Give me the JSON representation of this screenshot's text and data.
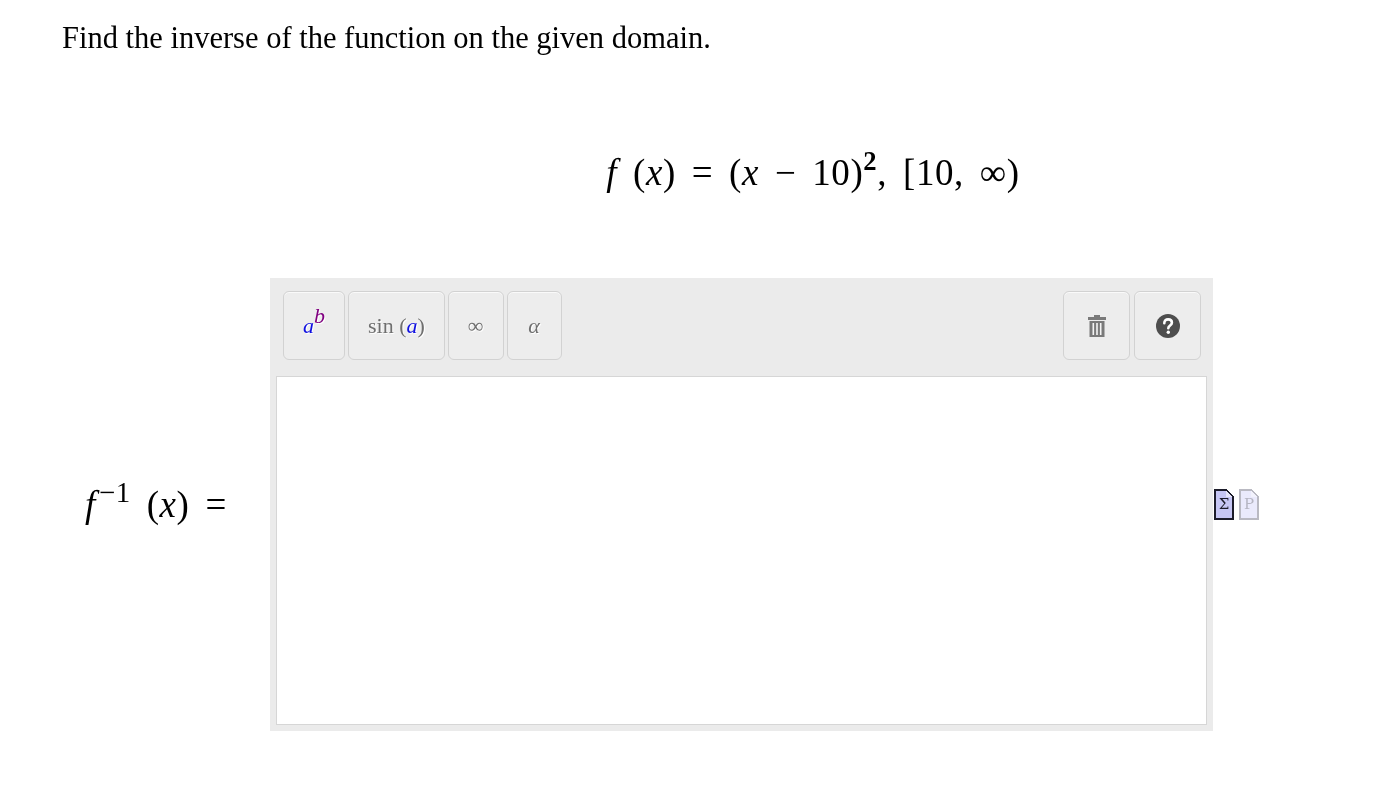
{
  "prompt": "Find the inverse of the function on the given domain.",
  "equation": "*f* (*x*) = (*x* − 10)$^{2}$, [10, ∞)",
  "answer": {
    "label": "*f*$^{−1}$ (*x*) =",
    "toolbar": {
      "buttons": [
        {
          "parts": [
            {
              "kind": "slot",
              "text": "a"
            },
            {
              "kind": "exponent",
              "text": "b"
            }
          ]
        },
        {
          "parts": [
            {
              "kind": "operator",
              "text": "sin ("
            },
            {
              "kind": "slot",
              "text": "a"
            },
            {
              "kind": "operator",
              "text": ")"
            }
          ]
        },
        {
          "parts": [
            {
              "kind": "operator",
              "text": "∞"
            }
          ]
        },
        {
          "parts": [
            {
              "kind": "letter",
              "text": "α"
            }
          ]
        }
      ],
      "tools": [
        {
          "kind": "trash"
        },
        {
          "kind": "help"
        }
      ]
    },
    "format_options": [
      {
        "symbol": "Σ",
        "selected": true
      },
      {
        "symbol": "P",
        "selected": false
      }
    ]
  }
}
